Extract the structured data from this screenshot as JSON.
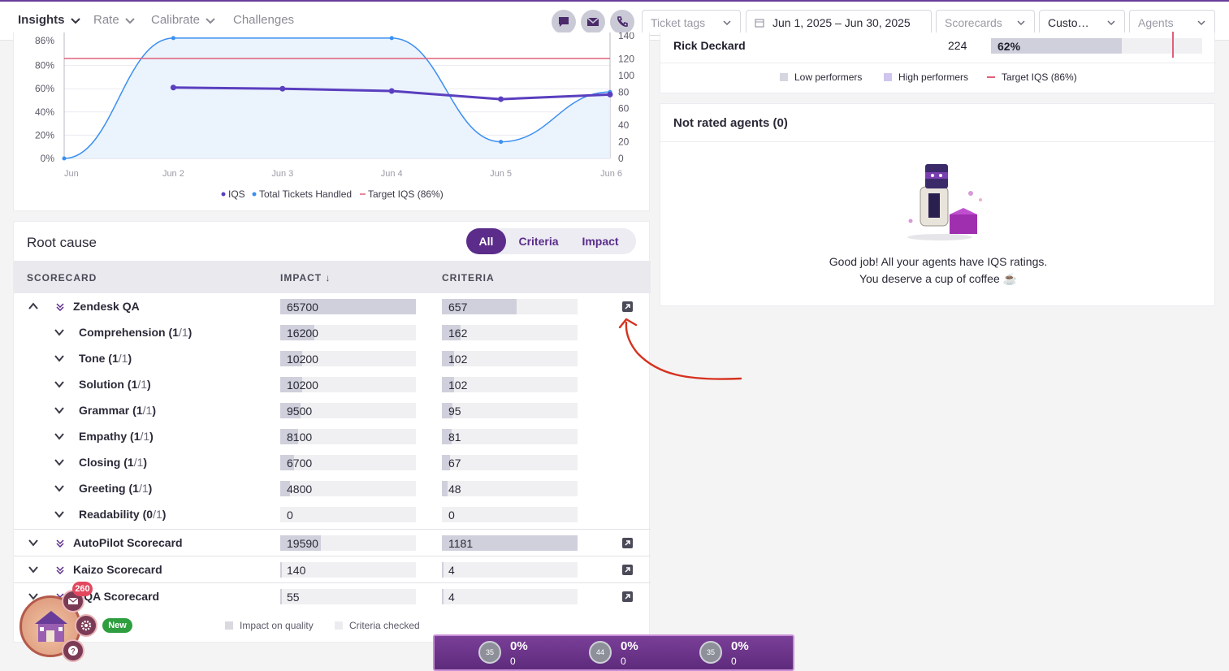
{
  "nav": {
    "tabs": [
      {
        "label": "Insights",
        "has_dropdown": true,
        "active": true
      },
      {
        "label": "Rate",
        "has_dropdown": true
      },
      {
        "label": "Calibrate",
        "has_dropdown": true
      },
      {
        "label": "Challenges",
        "has_dropdown": false
      }
    ],
    "channel_icons": [
      "chat-icon",
      "email-icon",
      "phone-icon"
    ],
    "filters": {
      "ticket_tags": "Ticket tags",
      "date_range": "Jun 1, 2025 – Jun 30, 2025",
      "scorecards": "Scorecards",
      "custom": "Custo…",
      "agents": "Agents"
    }
  },
  "chart_data": {
    "type": "line",
    "x": [
      "Jun",
      "Jun 2",
      "Jun 3",
      "Jun 4",
      "Jun 5",
      "Jun 6"
    ],
    "series": [
      {
        "name": "IQS",
        "axis": "left",
        "color": "#5a3fbf",
        "values": [
          null,
          61,
          60,
          58,
          51,
          55
        ]
      },
      {
        "name": "Total Tickets Handled",
        "axis": "right",
        "color": "#3b8ff0",
        "values": [
          0,
          145,
          null,
          145,
          20,
          80
        ]
      },
      {
        "name": "Target IQS (86%)",
        "axis": "left",
        "color": "#e0607a",
        "values": [
          86,
          86,
          86,
          86,
          86,
          86
        ]
      }
    ],
    "left_ticks": [
      "0%",
      "20%",
      "40%",
      "60%",
      "80%"
    ],
    "left_top_partial": "86%",
    "right_ticks": [
      "0",
      "20",
      "40",
      "60",
      "80",
      "100",
      "120"
    ],
    "right_top_partial": "140",
    "ylim_left": [
      0,
      100
    ],
    "ylim_right": [
      0,
      140
    ],
    "legend_position": "bottom"
  },
  "root_cause": {
    "title": "Root cause",
    "toggle": [
      "All",
      "Criteria",
      "Impact"
    ],
    "columns": {
      "scorecard": "SCORECARD",
      "impact": "IMPACT",
      "criteria": "CRITERIA"
    },
    "sort_indicator": "↓",
    "scorecards": [
      {
        "name": "Zendesk QA",
        "impact": "65700",
        "criteria": "657",
        "expanded": true,
        "impact_fill": 1.0,
        "criteria_fill": 0.55,
        "children": [
          {
            "name": "Comprehension",
            "frac_num": "1",
            "frac_den": "1",
            "impact": "16200",
            "criteria": "162",
            "impact_fill": 0.25,
            "criteria_fill": 0.14
          },
          {
            "name": "Tone",
            "frac_num": "1",
            "frac_den": "1",
            "impact": "10200",
            "criteria": "102",
            "impact_fill": 0.16,
            "criteria_fill": 0.09
          },
          {
            "name": "Solution",
            "frac_num": "1",
            "frac_den": "1",
            "impact": "10200",
            "criteria": "102",
            "impact_fill": 0.16,
            "criteria_fill": 0.09
          },
          {
            "name": "Grammar",
            "frac_num": "1",
            "frac_den": "1",
            "impact": "9500",
            "criteria": "95",
            "impact_fill": 0.15,
            "criteria_fill": 0.08
          },
          {
            "name": "Empathy",
            "frac_num": "1",
            "frac_den": "1",
            "impact": "8100",
            "criteria": "81",
            "impact_fill": 0.13,
            "criteria_fill": 0.07
          },
          {
            "name": "Closing",
            "frac_num": "1",
            "frac_den": "1",
            "impact": "6700",
            "criteria": "67",
            "impact_fill": 0.1,
            "criteria_fill": 0.06
          },
          {
            "name": "Greeting",
            "frac_num": "1",
            "frac_den": "1",
            "impact": "4800",
            "criteria": "48",
            "impact_fill": 0.07,
            "criteria_fill": 0.04
          },
          {
            "name": "Readability",
            "frac_num": "0",
            "frac_den": "1",
            "impact": "0",
            "criteria": "0",
            "impact_fill": 0.0,
            "criteria_fill": 0.0
          }
        ]
      },
      {
        "name": "AutoPilot Scorecard",
        "impact": "19590",
        "criteria": "1181",
        "expanded": false,
        "impact_fill": 0.3,
        "criteria_fill": 1.0
      },
      {
        "name": "Kaizo Scorecard",
        "impact": "140",
        "criteria": "4",
        "expanded": false,
        "impact_fill": 0.01,
        "criteria_fill": 0.01
      },
      {
        "name": "AutoQA Scorecard",
        "name_visible": "toQA Scorecard",
        "impact": "55",
        "criteria": "4",
        "expanded": false,
        "impact_fill": 0.01,
        "criteria_fill": 0.01
      }
    ],
    "footer_legend": [
      "Impact on quality",
      "Criteria checked"
    ]
  },
  "agent_panel": {
    "agent_name": "Rick Deckard",
    "count": "224",
    "pct": "62%",
    "pct_fill": 0.62,
    "legend": [
      "Low performers",
      "High performers",
      "Target IQS (86%)"
    ]
  },
  "not_rated": {
    "title": "Not rated agents (0)",
    "line1": "Good job! All your agents have IQS ratings.",
    "line2": "You deserve a cup of coffee ☕"
  },
  "game_widget": {
    "notification_count": "260",
    "new_label": "New"
  },
  "bottom_bar": {
    "items": [
      {
        "badge": "35",
        "pct": "0%",
        "count": "0"
      },
      {
        "badge": "44",
        "pct": "0%",
        "count": "0"
      },
      {
        "badge": "35",
        "pct": "0%",
        "count": "0"
      }
    ]
  },
  "colors": {
    "brand": "#5b2c8a",
    "iqs_line": "#5a3fbf",
    "tickets_line": "#3b8ff0",
    "target_line": "#e0607a",
    "annotation_arrow": "#d6321f"
  }
}
